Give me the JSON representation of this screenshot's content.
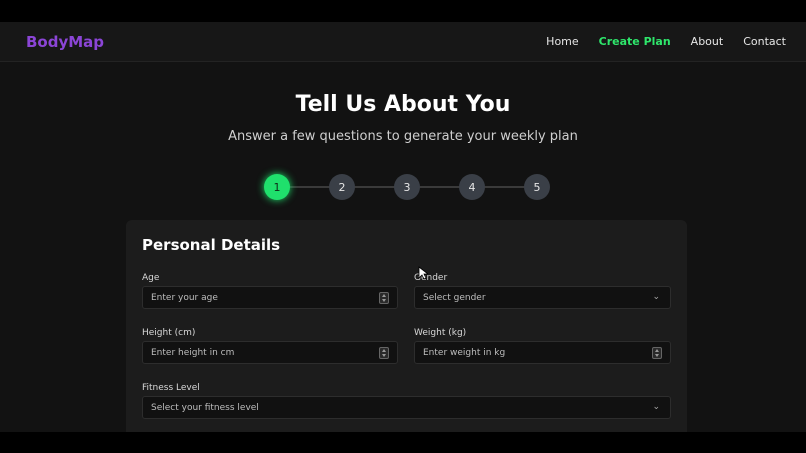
{
  "colors": {
    "brand": "#8b45d6",
    "accent": "#2ee66b",
    "step_active": "#1fe06c",
    "step_inactive": "#3a3f47"
  },
  "navbar": {
    "brand": "BodyMap",
    "links": [
      {
        "label": "Home",
        "active": false
      },
      {
        "label": "Create Plan",
        "active": true
      },
      {
        "label": "About",
        "active": false
      },
      {
        "label": "Contact",
        "active": false
      }
    ]
  },
  "hero": {
    "title": "Tell Us About You",
    "subtitle": "Answer a few questions to generate your weekly plan"
  },
  "stepper": {
    "current_step": 1,
    "steps": [
      "1",
      "2",
      "3",
      "4",
      "5"
    ]
  },
  "form": {
    "section_title": "Personal Details",
    "age": {
      "label": "Age",
      "placeholder": "Enter your age"
    },
    "gender": {
      "label": "Gender",
      "placeholder": "Select gender"
    },
    "height": {
      "label": "Height (cm)",
      "placeholder": "Enter height in cm"
    },
    "weight": {
      "label": "Weight (kg)",
      "placeholder": "Enter weight in kg"
    },
    "fitness": {
      "label": "Fitness Level",
      "placeholder": "Select your fitness level"
    }
  }
}
